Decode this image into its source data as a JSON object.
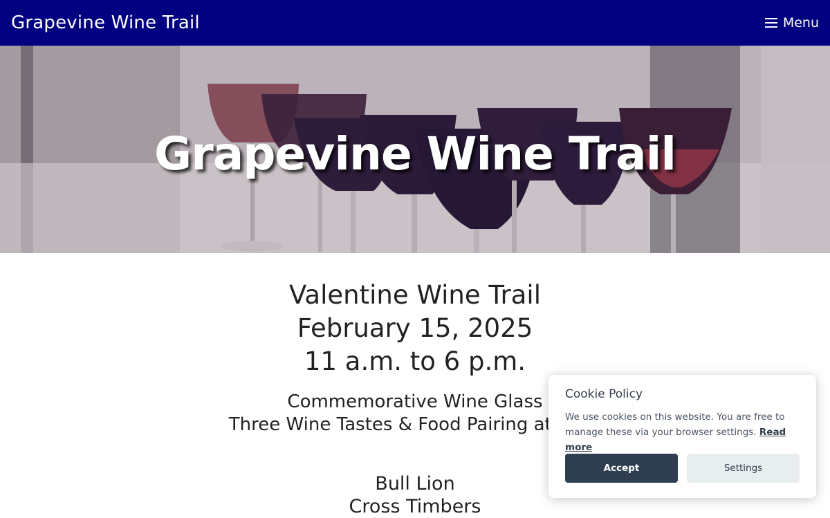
{
  "header": {
    "site_title": "Grapevine Wine Trail",
    "menu_label": "Menu"
  },
  "hero": {
    "title": "Grapevine Wine Trail"
  },
  "main": {
    "event_name": "Valentine Wine Trail",
    "event_date": "February 15, 2025",
    "event_time": "11 a.m. to 6 p.m.",
    "perks": [
      "Commemorative Wine Glass",
      "Three Wine Tastes & Food Pairing at Each"
    ],
    "wineries": [
      "Bull Lion",
      "Cross Timbers"
    ]
  },
  "cookie": {
    "title": "Cookie Policy",
    "text": "We use cookies on this website. You are free to manage these via your browser settings.",
    "read_more": "Read more",
    "accept_label": "Accept",
    "settings_label": "Settings"
  },
  "colors": {
    "header_bg": "#000080",
    "accept_bg": "#2e3d50",
    "settings_bg": "#e8edf0"
  }
}
